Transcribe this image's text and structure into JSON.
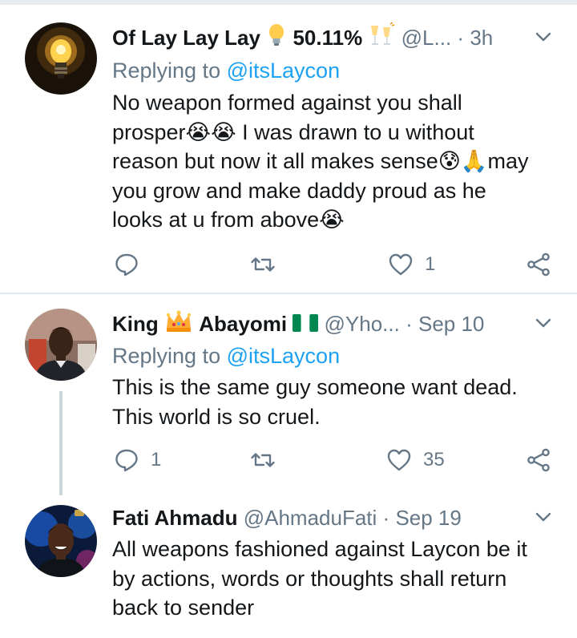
{
  "tweets": [
    {
      "name": "Of Lay Lay Lay",
      "name_suffix": "50.11%",
      "handle": "@L...",
      "dot": "·",
      "time": "3h",
      "reply_prefix": "Replying to",
      "reply_mention": "@itsLaycon",
      "lines": [
        "No weapon formed against you shall",
        "prosper😭😭 I was drawn to u without",
        "reason but now it all makes sense😰🙏may",
        "you grow and make daddy proud as he",
        "looks at u from above😭"
      ],
      "replies": "",
      "retweets": "",
      "likes": "1"
    },
    {
      "name": "King",
      "name_suffix": "Abayomi",
      "handle": "@Yho...",
      "dot": "·",
      "time": "Sep 10",
      "reply_prefix": "Replying to",
      "reply_mention": "@itsLaycon",
      "lines": [
        "This is the same guy someone want dead.",
        "This world is so cruel."
      ],
      "replies": "1",
      "retweets": "",
      "likes": "35"
    },
    {
      "name": "Fati Ahmadu",
      "handle": "@AhmaduFati",
      "dot": "·",
      "time": "Sep 19",
      "lines": [
        "All weapons fashioned against Laycon be it",
        "by actions, words or thoughts shall return",
        "back to sender"
      ]
    }
  ],
  "colors": {
    "text": "#14171a",
    "muted": "#657786",
    "accent": "#1da1f2",
    "separator": "#e1e8ed"
  },
  "icons": [
    "bulb-emoji",
    "champagne-emoji",
    "crown-emoji",
    "nigeria-flag",
    "chevron-down-icon",
    "reply-icon",
    "retweet-icon",
    "like-icon",
    "share-icon"
  ]
}
